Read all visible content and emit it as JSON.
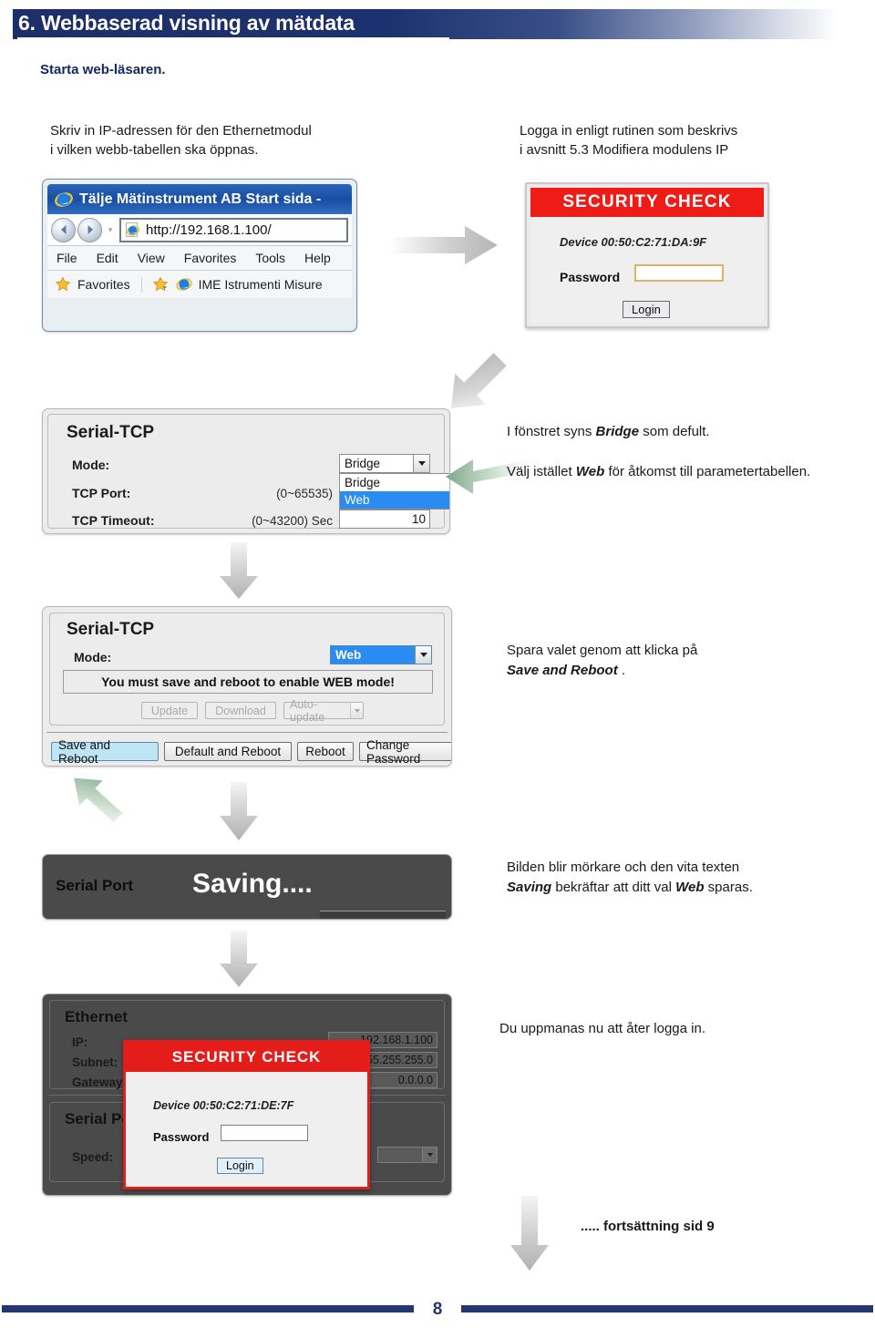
{
  "header": {
    "title": "6.  Webbaserad visning av mätdata"
  },
  "intro": {
    "subtitle": "Starta web-läsaren.",
    "left_line1": "Skriv in IP-adressen för den Ethernetmodul",
    "left_line2": "i vilken webb-tabellen ska öppnas.",
    "right_line1": "Logga in enligt rutinen som beskrivs",
    "right_line2": "i avsnitt 5.3 Modifiera modulens IP"
  },
  "browser": {
    "title": "Tälje Mätinstrument AB Start sida -",
    "address": "http://192.168.1.100/",
    "menu": [
      "File",
      "Edit",
      "View",
      "Favorites",
      "Tools",
      "Help"
    ],
    "favorites_label": "Favorites",
    "favorites_item": "IME Istrumenti Misure"
  },
  "security_top": {
    "header": "SECURITY CHECK",
    "device": "Device 00:50:C2:71:DA:9F",
    "password_label": "Password",
    "password_value": "",
    "login_label": "Login"
  },
  "serial_tcp_1": {
    "title": "Serial-TCP",
    "mode_label": "Mode:",
    "mode_value": "Bridge",
    "options": [
      "Bridge",
      "Web"
    ],
    "selected_option": "Web",
    "tcp_port_label": "TCP Port:",
    "tcp_port_range": "(0~65535)",
    "tcp_timeout_label": "TCP Timeout:",
    "tcp_timeout_range": "(0~43200) Sec",
    "tcp_timeout_value": "10"
  },
  "serial_tcp_2": {
    "title": "Serial-TCP",
    "mode_label": "Mode:",
    "mode_value": "Web",
    "warning": "You must save and reboot to enable WEB mode!",
    "update_label": "Update",
    "download_label": "Download",
    "autoupdate_label": "Auto-update",
    "save_and_reboot_label": "Save and Reboot",
    "default_and_reboot_label": "Default and Reboot",
    "reboot_label": "Reboot",
    "change_password_label": "Change Password"
  },
  "saving_panel": {
    "serial_port_label": "Serial Port",
    "saving_text": "Saving...."
  },
  "ethernet_panel": {
    "title": "Ethernet",
    "ip_label": "IP:",
    "ip_value": "192.168.1.100",
    "subnet_label": "Subnet:",
    "subnet_value": "255.255.255.0",
    "gateway_label": "Gateway:",
    "gateway_value": "0.0.0.0",
    "serial_port_title": "Serial Port",
    "speed_label": "Speed:"
  },
  "security_bottom": {
    "header": "SECURITY CHECK",
    "device": "Device 00:50:C2:71:DE:7F",
    "password_label": "Password",
    "password_value": "",
    "login_label": "Login"
  },
  "notes": {
    "note1_pre": "I fönstret syns ",
    "note1_bold": "Bridge",
    "note1_post": " som defult.",
    "note2_pre": "Välj istället ",
    "note2_bold": "Web",
    "note2_post": " för åtkomst till parametertabellen.",
    "note3_line1": "Spara valet genom att klicka på",
    "note3_bold": "Save and Reboot",
    "note3_post": " .",
    "note4_line1": "Bilden blir mörkare och den vita texten",
    "note4_bold1": "Saving",
    "note4_mid": " bekräftar att ditt val ",
    "note4_bold2": "Web",
    "note4_post": " sparas.",
    "note5": "Du uppmanas nu att åter logga in.",
    "note6": "..... fortsättning sid 9"
  },
  "footer": {
    "page_number": "8"
  },
  "colors": {
    "header_blue": "#1c2f6b",
    "footer_blue": "#23376e",
    "security_red": "#ee1b17",
    "highlight_blue": "#2a8cf0",
    "accent_green": "#8fb698"
  }
}
